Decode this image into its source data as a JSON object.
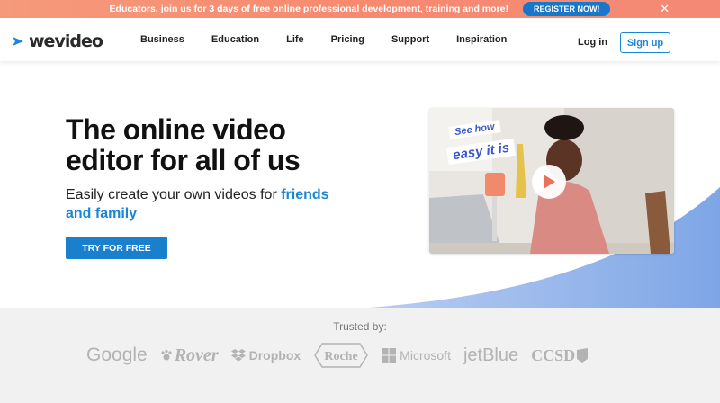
{
  "promo": {
    "text": "Educators, join us for 3 days of free online professional development, training and more!",
    "button_label": "REGISTER NOW!",
    "close_icon": "close-icon",
    "close_glyph": "✕"
  },
  "nav": {
    "logo_text": "wevideo",
    "links": [
      "Business",
      "Education",
      "Life",
      "Pricing",
      "Support",
      "Inspiration"
    ],
    "login_label": "Log in",
    "signup_label": "Sign up"
  },
  "hero": {
    "title": "The online video editor for all of us",
    "subtitle_prefix": "Easily create your own videos for ",
    "subtitle_accent": "friends and family",
    "cta_label": "TRY FOR FREE",
    "video_tag_line1": "See how",
    "video_tag_line2": "easy it is",
    "play_icon": "play-icon"
  },
  "trusted": {
    "label": "Trusted by:",
    "brands": [
      "Google",
      "Rover",
      "Dropbox",
      "Roche",
      "Microsoft",
      "jetBlue",
      "CCSD"
    ]
  },
  "colors": {
    "accent_blue": "#1a86d6",
    "promo_bg": "#f7896f",
    "register_button": "#1877c8",
    "trusted_bg": "#f1f1f1",
    "swoosh": "#7ea6e6"
  }
}
